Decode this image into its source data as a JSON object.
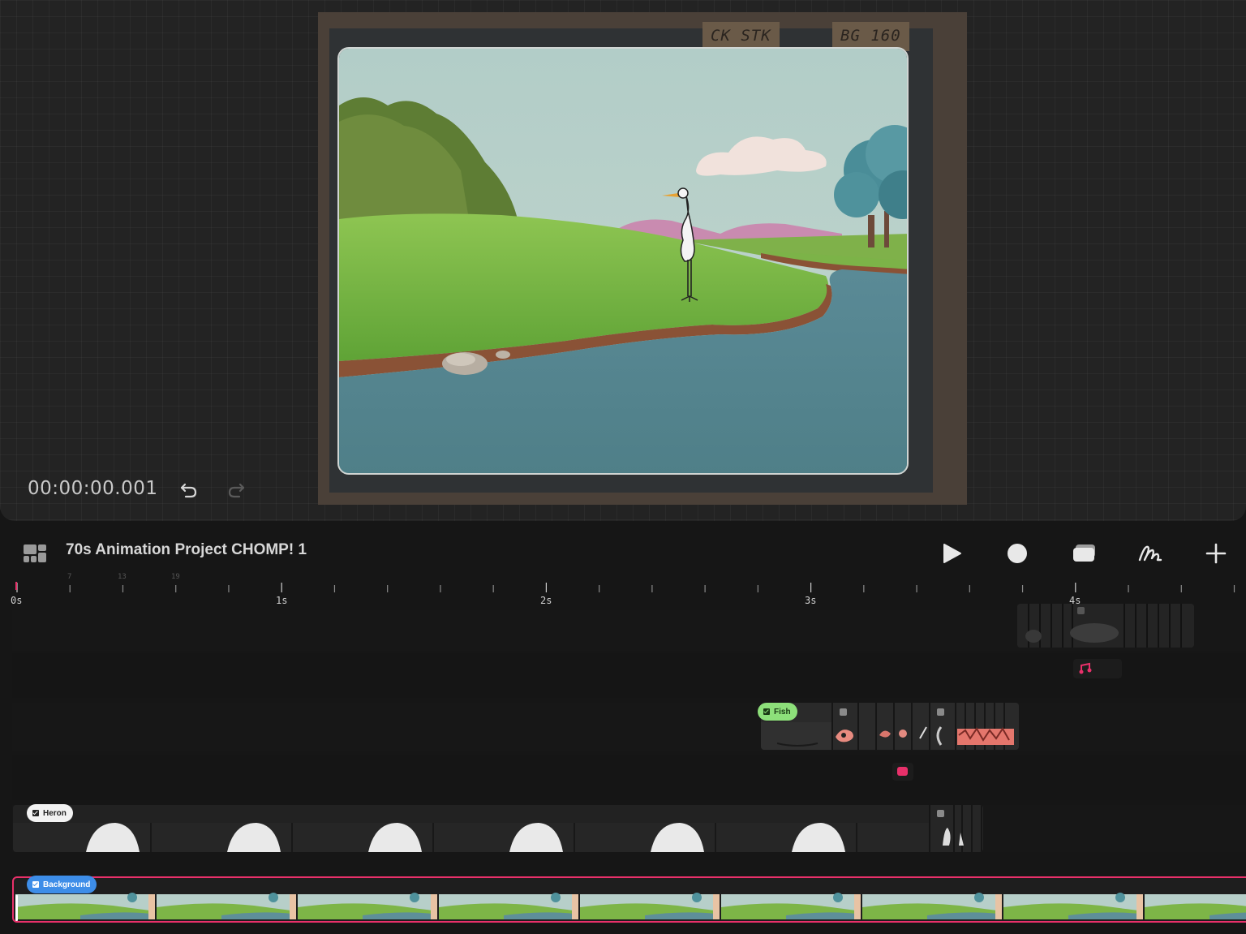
{
  "canvas": {
    "timecode": "00:00:00.001",
    "paper_labels": [
      "CK STK",
      "BG 160"
    ]
  },
  "toolbar": {
    "project_title": "70s Animation Project CHOMP! 1",
    "layout_icon": "layout-grid-icon",
    "play_icon": "play-icon",
    "record_icon": "record-icon",
    "layers_icon": "layers-icon",
    "draw_icon": "draw-squiggle-icon",
    "add_icon": "plus-icon"
  },
  "ruler": {
    "seconds": [
      "0s",
      "1s",
      "2s",
      "3s",
      "4s"
    ],
    "frames": [
      "7",
      "13",
      "19"
    ]
  },
  "tracks": {
    "fish": {
      "label": "Fish"
    },
    "heron": {
      "label": "Heron"
    },
    "background": {
      "label": "Background"
    }
  },
  "colors": {
    "accent_red": "#e8306a",
    "fish_tag": "#8de07a",
    "heron_tag": "#f2f2f2",
    "background_tag": "#3d8de8"
  }
}
